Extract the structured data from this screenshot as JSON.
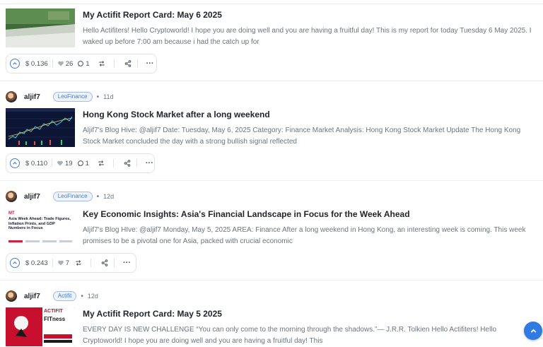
{
  "posts": [
    {
      "title": "My Actifit Report Card: May 6 2025",
      "excerpt": "Hello Actifiters! Hello Cryptoworld! I hope you are doing well and you are having a fruitful day! This is my report for today Tuesday 6 May 2025. I waked up before 7:00 am because i had the catch up for",
      "payout": "$ 0.136",
      "likes": "26",
      "comments": "1"
    },
    {
      "author": "aljif7",
      "community": "LeoFinance",
      "dot": "•",
      "time": "11d",
      "title": "Hong Kong Stock Market after a long weekend",
      "excerpt": "Aljif7's Blog Hive: @aljif7 Date: Tuesday, May 6, 2025 Category: Finance Market Analysis: Hong Kong Stock Market Update The Hong Kong Stock Market concluded the day with a strong bullish signal reflected",
      "payout": "$ 0.110",
      "likes": "19",
      "comments": "1"
    },
    {
      "author": "aljif7",
      "community": "LeoFinance",
      "dot": "•",
      "time": "12d",
      "title": "Key Economic Insights: Asia's Financial Landscape in Focus for the Week Ahead",
      "excerpt": "Aljif7's Blog HIve: @aljif7 Monday, May 5, 2025 AREA: Finance After a long weekend in Hong Kong, an interesting week is coming. This week promises to be a pivotal one for Asia, packed with crucial economic",
      "payout": "$ 0.243",
      "likes": "7",
      "thumb_headline": "Asia Week Ahead: Trade Figures, Inflation Prints, and GDP Numbers in Focus",
      "thumb_logo": "MT"
    },
    {
      "author": "aljif7",
      "community": "Actifit",
      "dot": "•",
      "time": "12d",
      "title": "My Actifit Report Card: May 5 2025",
      "excerpt": "EVERY DAY IS NEW CHALLENGE “You can only come to the morning through the shadows.”— J.R.R. Tolkien Hello Actifiters! Hello Cryptoworld! I hope you are doing well and you are having a fruitful day! This",
      "thumb_text1": "ACTIFIT",
      "thumb_text2": "FITness"
    }
  ],
  "icons": {
    "upvote": "chevron-up-icon",
    "like": "heart-icon",
    "comment": "comment-icon",
    "reblog": "reblog-icon",
    "share": "share-icon",
    "more": "more-icon",
    "fab": "chevron-up-icon"
  },
  "colors": {
    "accent": "#4a7bd0",
    "fab": "#2f7be3"
  }
}
